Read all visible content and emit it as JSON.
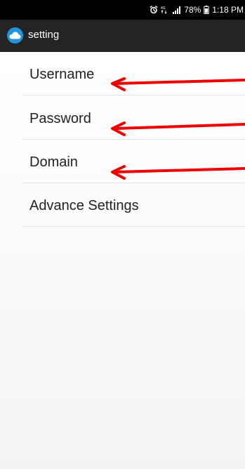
{
  "status_bar": {
    "network_text": "4G",
    "battery_text": "78%",
    "time": "1:18 PM",
    "icons": [
      "alarm-icon",
      "network-icon",
      "signal-icon",
      "battery-icon"
    ]
  },
  "toolbar": {
    "app_icon": "cloud-icon",
    "title": "setting"
  },
  "settings": {
    "items": [
      {
        "label": "Username"
      },
      {
        "label": "Password"
      },
      {
        "label": "Domain"
      },
      {
        "label": "Advance Settings"
      }
    ]
  },
  "annotations": {
    "arrow_color": "#ee0000",
    "arrows": [
      "left-arrow",
      "left-arrow",
      "left-arrow"
    ]
  },
  "colors": {
    "status_bar_background": "#000000",
    "toolbar_background": "#242424",
    "app_icon_color": "#1f95de",
    "text_color": "#222222",
    "divider_color": "#e2e2e2"
  }
}
